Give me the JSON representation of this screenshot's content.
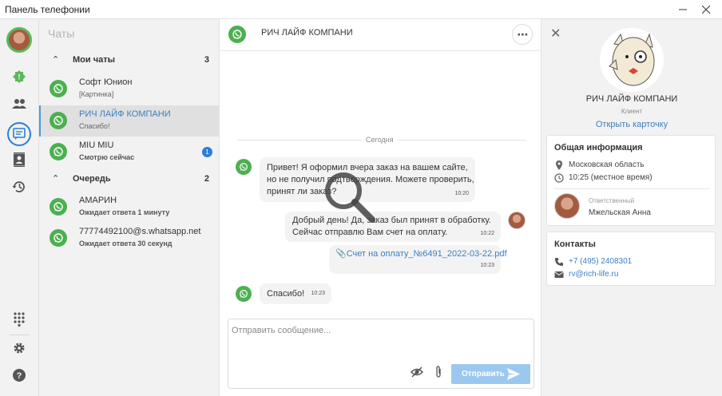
{
  "window": {
    "title": "Панель телефонии"
  },
  "chatlist": {
    "header": "Чаты",
    "my_chats": {
      "label": "Мои чаты",
      "count": "3"
    },
    "queue": {
      "label": "Очередь",
      "count": "2"
    },
    "items": [
      {
        "name": "Софт Юнион",
        "sub": "[Картинка]"
      },
      {
        "name": "РИЧ ЛАЙФ КОМПАНИ",
        "sub": "Спасибо!"
      },
      {
        "name": "MIU MIU",
        "sub": "Смотрю сейчас",
        "badge": "1"
      },
      {
        "name": "АМАРИН",
        "sub": "Ожидает ответа 1 минуту"
      },
      {
        "name": "77774492100@s.whatsapp.net",
        "sub": "Ожидает ответа 30 секунд"
      }
    ]
  },
  "conversation": {
    "title": "РИЧ ЛАЙФ КОМПАНИ",
    "date_label": "Сегодня",
    "messages": [
      {
        "line1": "Привет! Я оформил вчера заказ на вашем сайте,",
        "line2": "но не получил подтверждения. Можете проверить,",
        "line3": "принят ли заказ?",
        "time": "10:20"
      },
      {
        "line1": "Добрый день! Да, заказ был принят в обработку.",
        "line2": "Сейчас отправлю Вам счет на оплату.",
        "time": "10:22"
      },
      {
        "file": "Счет на оплату_№6491_2022-03-22.pdf",
        "time": "10:23"
      },
      {
        "text": "Спасибо!",
        "time": "10:23"
      }
    ],
    "composer": {
      "placeholder": "Отправить сообщение...",
      "send_label": "Отправить"
    }
  },
  "info": {
    "client_name": "РИЧ ЛАЙФ КОМПАНИ",
    "client_role": "Клиент",
    "open_card": "Открыть карточку",
    "general": {
      "title": "Общая информация",
      "region": "Московская область",
      "local_time": "10:25 (местное время)",
      "responsible_label": "Ответственный",
      "responsible_name": "Мжельская Анна"
    },
    "contacts": {
      "title": "Контакты",
      "phone": "+7 (495) 2408301",
      "email": "rv@rich-life.ru"
    }
  },
  "colors": {
    "accent": "#3d7fbf",
    "whatsapp": "#4cb050",
    "send_button": "#9cc8f0",
    "badge": "#2b7fd4"
  }
}
